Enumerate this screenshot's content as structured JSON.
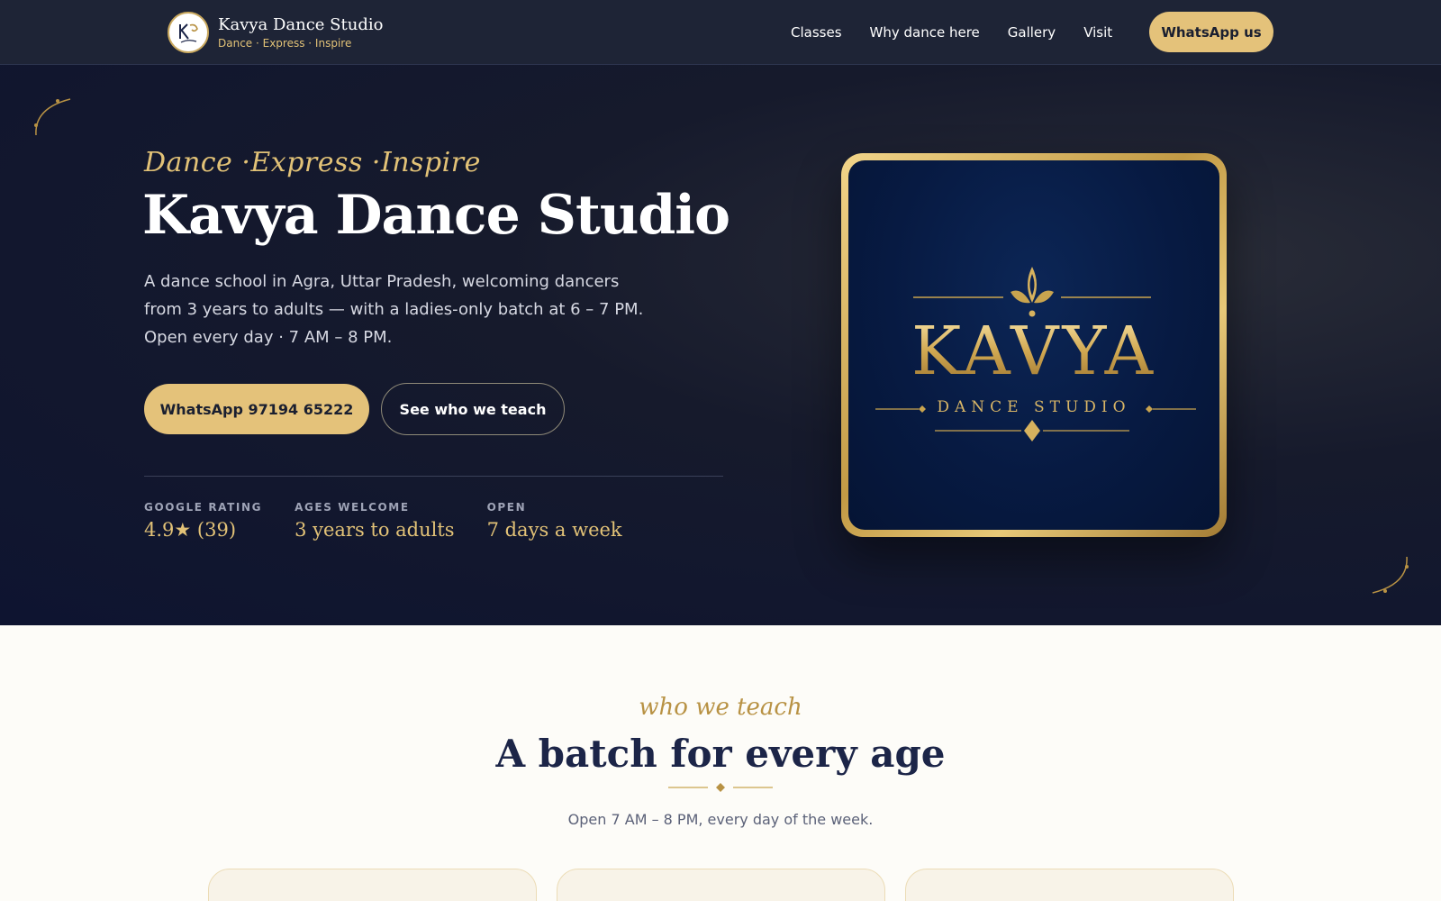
{
  "header": {
    "brand_name": "Kavya Dance Studio",
    "brand_tagline": "Dance · Express · Inspire",
    "nav": [
      {
        "label": "Classes"
      },
      {
        "label": "Why dance here"
      },
      {
        "label": "Gallery"
      },
      {
        "label": "Visit"
      }
    ],
    "cta_label": "WhatsApp us"
  },
  "hero": {
    "script_tagline": "Dance ·Express ·Inspire",
    "title": "Kavya Dance Studio",
    "description": "A dance school in Agra, Uttar Pradesh, welcoming dancers from 3 years to adults — with a ladies-only batch at 6 – 7 PM. Open every day · 7 AM – 8 PM.",
    "primary_button": "WhatsApp 97194 65222",
    "secondary_button": "See who we teach",
    "stats": [
      {
        "label": "GOOGLE RATING",
        "value": "4.9★ (39)"
      },
      {
        "label": "AGES WELCOME",
        "value": "3 years to adults"
      },
      {
        "label": "OPEN",
        "value": "7 days a week"
      }
    ],
    "logo_card": {
      "word": "KAVYA",
      "sub": "DANCE STUDIO"
    }
  },
  "section": {
    "script": "who we teach",
    "title": "A batch for every age",
    "note": "Open 7 AM – 8 PM, every day of the week."
  },
  "colors": {
    "navy": "#0e1430",
    "gold": "#e4c27a",
    "cream": "#fdfcf8"
  }
}
